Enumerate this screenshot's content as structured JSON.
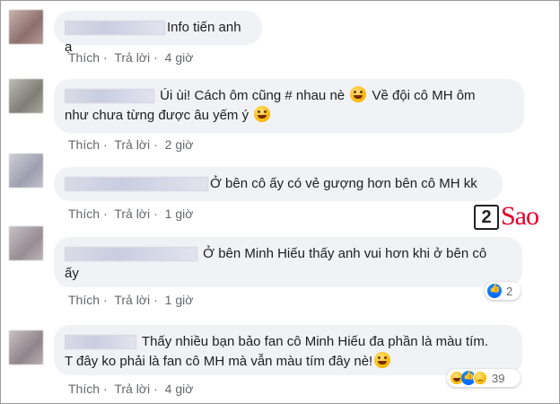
{
  "comments": [
    {
      "text": "Info tiến anh ạ",
      "actions": {
        "like": "Thích",
        "reply": "Trả lời",
        "time": "4 giờ"
      }
    },
    {
      "text": "Úi ùi! Cách ôm cũng # nhau nè 😛 Về đội cô MH ôm như chưa từng được âu yếm ý 😛",
      "line1": "Úi ùi! Cách ôm cũng # nhau nè",
      "line1b": "Về đội cô MH ôm",
      "line2": "như chưa từng được âu yếm ý",
      "actions": {
        "like": "Thích",
        "reply": "Trả lời",
        "time": "2 giờ"
      }
    },
    {
      "text": "Ở bên cô ấy có vẻ gượng hơn bên cô MH kk",
      "actions": {
        "like": "Thích",
        "reply": "Trả lời",
        "time": "1 giờ"
      }
    },
    {
      "text": "Ở bên Minh Hiếu thấy anh vui hơn khi ở bên cô ấy",
      "line1": "Ở bên Minh Hiếu thấy anh vui hơn khi ở bên cô",
      "line2": "ấy",
      "actions": {
        "like": "Thích",
        "reply": "Trả lời",
        "time": "1 giờ"
      },
      "reaction_count": "2"
    },
    {
      "text": "Thấy nhiều bạn bảo fan cô Minh Hiếu đa phần là màu tím. T đây ko phải là fan cô MH mà vẫn màu tím đây nè!😆",
      "line1": "Thấy nhiều bạn bảo fan cô Minh Hiếu đa phần là màu tím.",
      "line2": "T đây ko phải là fan cô MH mà vẫn màu tím đây nè!",
      "actions": {
        "like": "Thích",
        "reply": "Trả lời",
        "time": "4 giờ"
      },
      "reaction_count": "39"
    }
  ],
  "watermark": {
    "digit": "2",
    "word": "Sao",
    "color": "#e0002a"
  },
  "icons": [
    "avatar",
    "tongue-out-emoji-icon",
    "grinning-emoji-icon",
    "like-reaction-icon",
    "haha-reaction-icon",
    "wow-reaction-icon",
    "sad-reaction-icon"
  ],
  "colors": {
    "bubble": "#f0f2f5",
    "secondary_text": "#65676b",
    "like_blue": "#0866ff"
  }
}
